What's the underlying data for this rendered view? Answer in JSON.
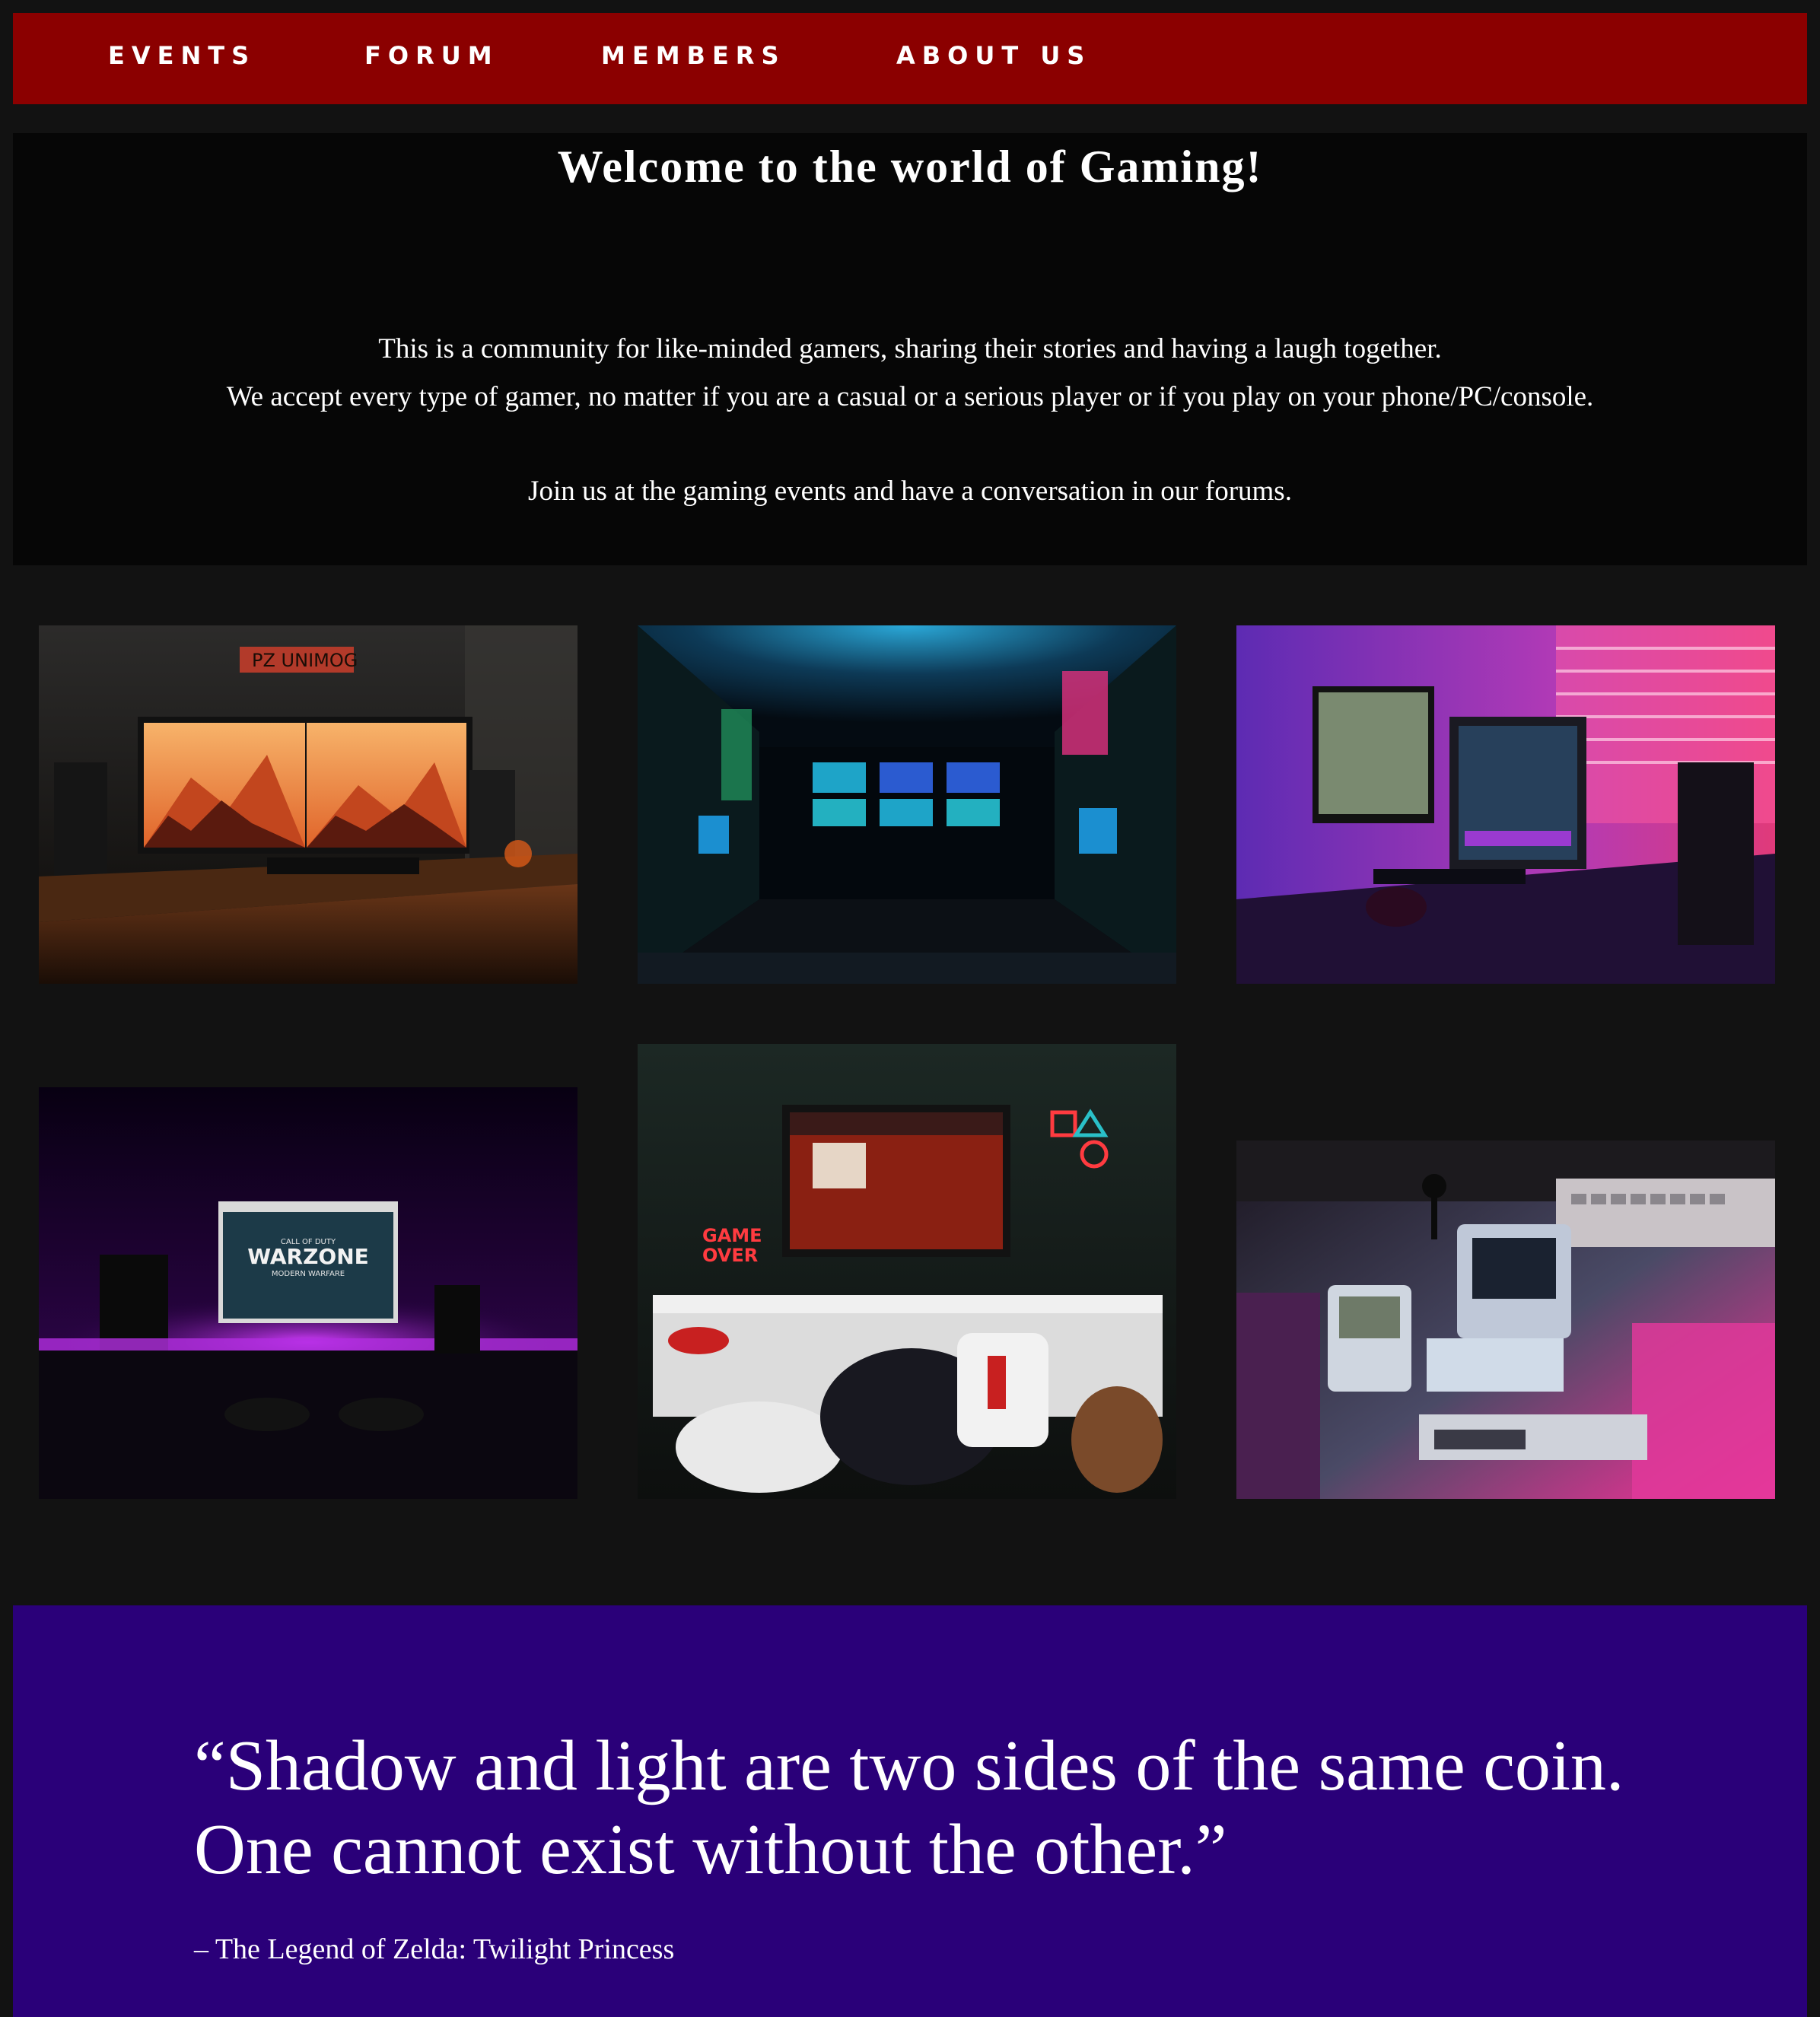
{
  "nav": {
    "items": [
      {
        "label": "EVENTS"
      },
      {
        "label": "FORUM"
      },
      {
        "label": "MEMBERS"
      },
      {
        "label": "ABOUT US"
      }
    ]
  },
  "welcome": {
    "title": "Welcome to the world of Gaming!",
    "line1": "This is a community for like-minded gamers, sharing their stories and having a laugh together.",
    "line2": "We accept every type of gamer, no matter if you are a casual or a serious player or if you play on your phone/PC/console.",
    "line3": "Join us at the gaming events and have a conversation in our forums."
  },
  "gallery": {
    "photos": [
      {
        "sign_text": "PZ UNIMOG"
      },
      {
        "sign_text": ""
      },
      {
        "sign_text": ""
      },
      {
        "screen_title": "WARZONE",
        "screen_small": "CALL OF DUTY",
        "screen_sub": "MODERN WARFARE"
      },
      {
        "neon_text_1": "GAME",
        "neon_text_2": "OVER"
      },
      {
        "sign_text": ""
      }
    ]
  },
  "quote": {
    "text": "“Shadow and light are two sides of the same coin. One cannot exist without the other.”",
    "source": "– The Legend of Zelda: Twilight Princess"
  },
  "colors": {
    "page_bg": "#121212",
    "nav_bg": "#8b0000",
    "welcome_bg": "#060606",
    "quote_bg": "#2a0079",
    "text": "#ffffff"
  }
}
